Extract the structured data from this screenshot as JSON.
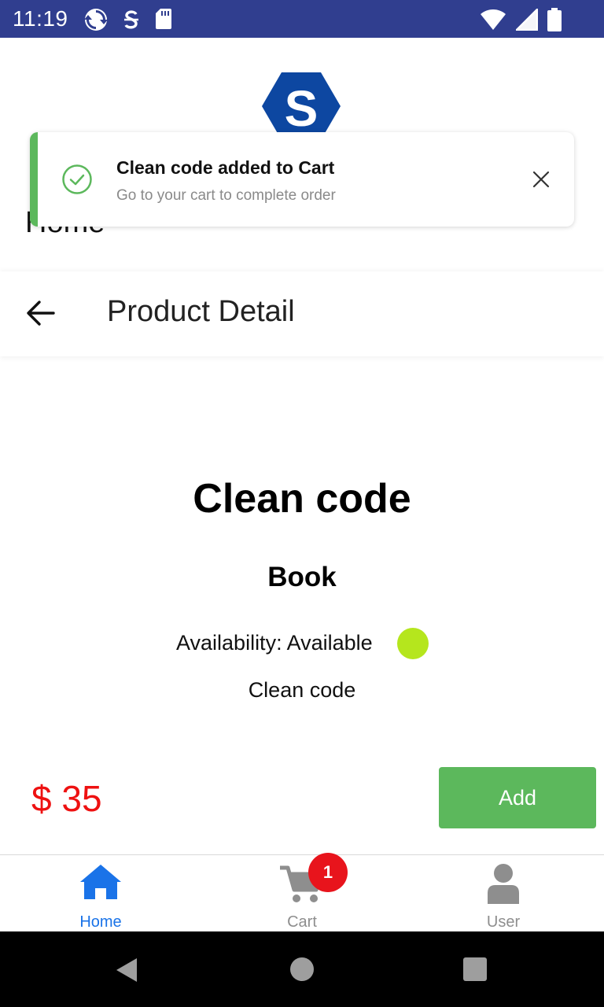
{
  "status_bar": {
    "time": "11:19",
    "icons": [
      "sync-icon",
      "sim-toolkit-icon",
      "sd-card-icon",
      "wifi-icon",
      "signal-icon",
      "battery-icon"
    ]
  },
  "header": {
    "logo_letter": "S",
    "title": "Home"
  },
  "toast": {
    "title": "Clean code added to Cart",
    "message": "Go to your cart to complete order",
    "accent_color": "#5cb85c"
  },
  "app_bar": {
    "title": "Product Detail"
  },
  "product": {
    "name": "Clean code",
    "category": "Book",
    "availability_label": "Availability: Available",
    "availability_color": "#b5e61d",
    "description": "Clean code",
    "price": "$ 35",
    "add_label": "Add"
  },
  "tabs": [
    {
      "label": "Home",
      "icon": "home-icon",
      "active": true,
      "color": "#1a73e8"
    },
    {
      "label": "Cart",
      "icon": "cart-icon",
      "active": false,
      "color": "#8e8e8e",
      "badge": "1"
    },
    {
      "label": "User",
      "icon": "user-icon",
      "active": false,
      "color": "#8e8e8e"
    }
  ],
  "colors": {
    "status_bar": "#303e8f",
    "price": "#ee1111",
    "button": "#5cb85c",
    "badge": "#e8141c",
    "active_tab": "#1a73e8"
  }
}
